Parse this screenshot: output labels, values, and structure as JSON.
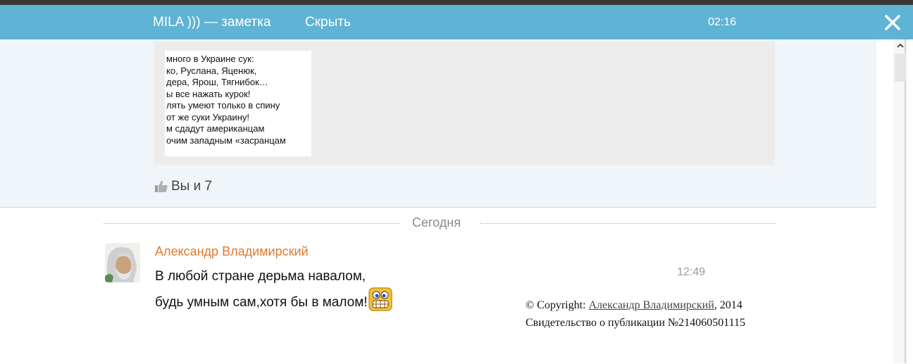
{
  "header": {
    "title": "MILA ))) — заметка",
    "hide_label": "Скрыть",
    "time": "02:16",
    "close_icon": "close-icon",
    "background_color": "#5fb3d4"
  },
  "post": {
    "image_text_lines": [
      "много в Украине сук:",
      "ко, Руслана, Яценюк,",
      "дера, Ярош, Тягнибок…",
      "ы все нажать курок!",
      "лять умеют только в спину",
      "от же суки Украину!",
      "м сдадут американцам",
      "очим западным «засранцам"
    ],
    "likes_label": "Вы и 7",
    "like_icon": "thumbs-up-icon"
  },
  "feed": {
    "date_divider": "Сегодня"
  },
  "comment": {
    "author": "Александр Владимирский",
    "line1": "В любой стране дерьма навалом,",
    "line2": "будь умным сам,хотя бы в малом!",
    "time": "12:49",
    "author_color": "#e07a2e",
    "emoji_icon": "grinning-smiley-icon"
  },
  "copyright": {
    "prefix": "© Copyright: ",
    "author_link": "Александр Владимирский",
    "year_suffix": ", 2014",
    "certificate": "Свидетельство о публикации №214060501115"
  }
}
